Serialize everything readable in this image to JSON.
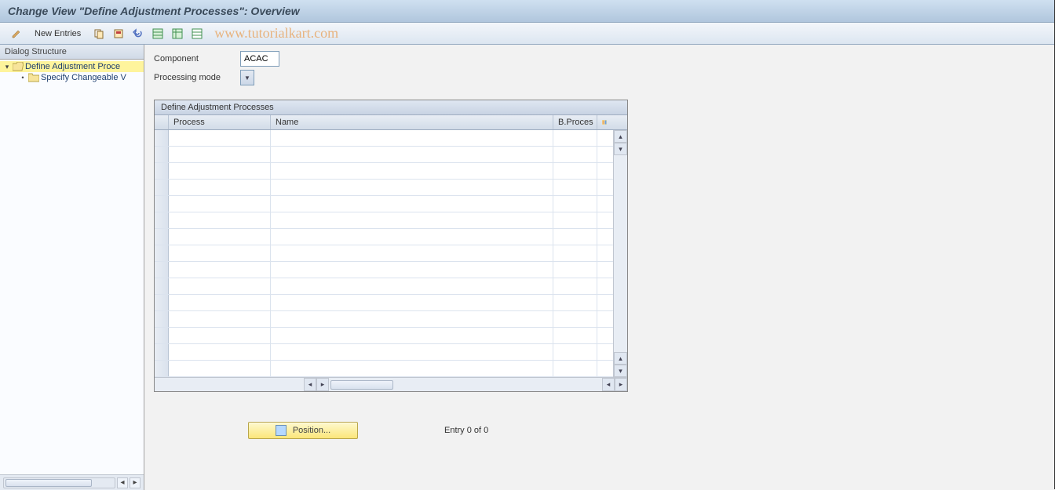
{
  "title": "Change View \"Define Adjustment Processes\": Overview",
  "toolbar": {
    "new_entries_label": "New Entries"
  },
  "watermark": "www.tutorialkart.com",
  "sidebar": {
    "header": "Dialog Structure",
    "items": [
      {
        "label": "Define Adjustment Proce",
        "selected": true,
        "level": 0
      },
      {
        "label": "Specify Changeable V",
        "selected": false,
        "level": 1
      }
    ]
  },
  "form": {
    "component_label": "Component",
    "component_value": "ACAC",
    "processing_mode_label": "Processing mode",
    "processing_mode_value": ""
  },
  "table": {
    "title": "Define Adjustment Processes",
    "columns": [
      "Process",
      "Name",
      "B.Proces"
    ],
    "row_count": 15
  },
  "footer": {
    "position_label": "Position...",
    "entry_status": "Entry 0 of 0"
  },
  "colors": {
    "header_gradient_top": "#cfe0f0",
    "header_gradient_bottom": "#b0c6dd",
    "selected_row": "#fef49c",
    "position_button": "#fbe67a"
  }
}
